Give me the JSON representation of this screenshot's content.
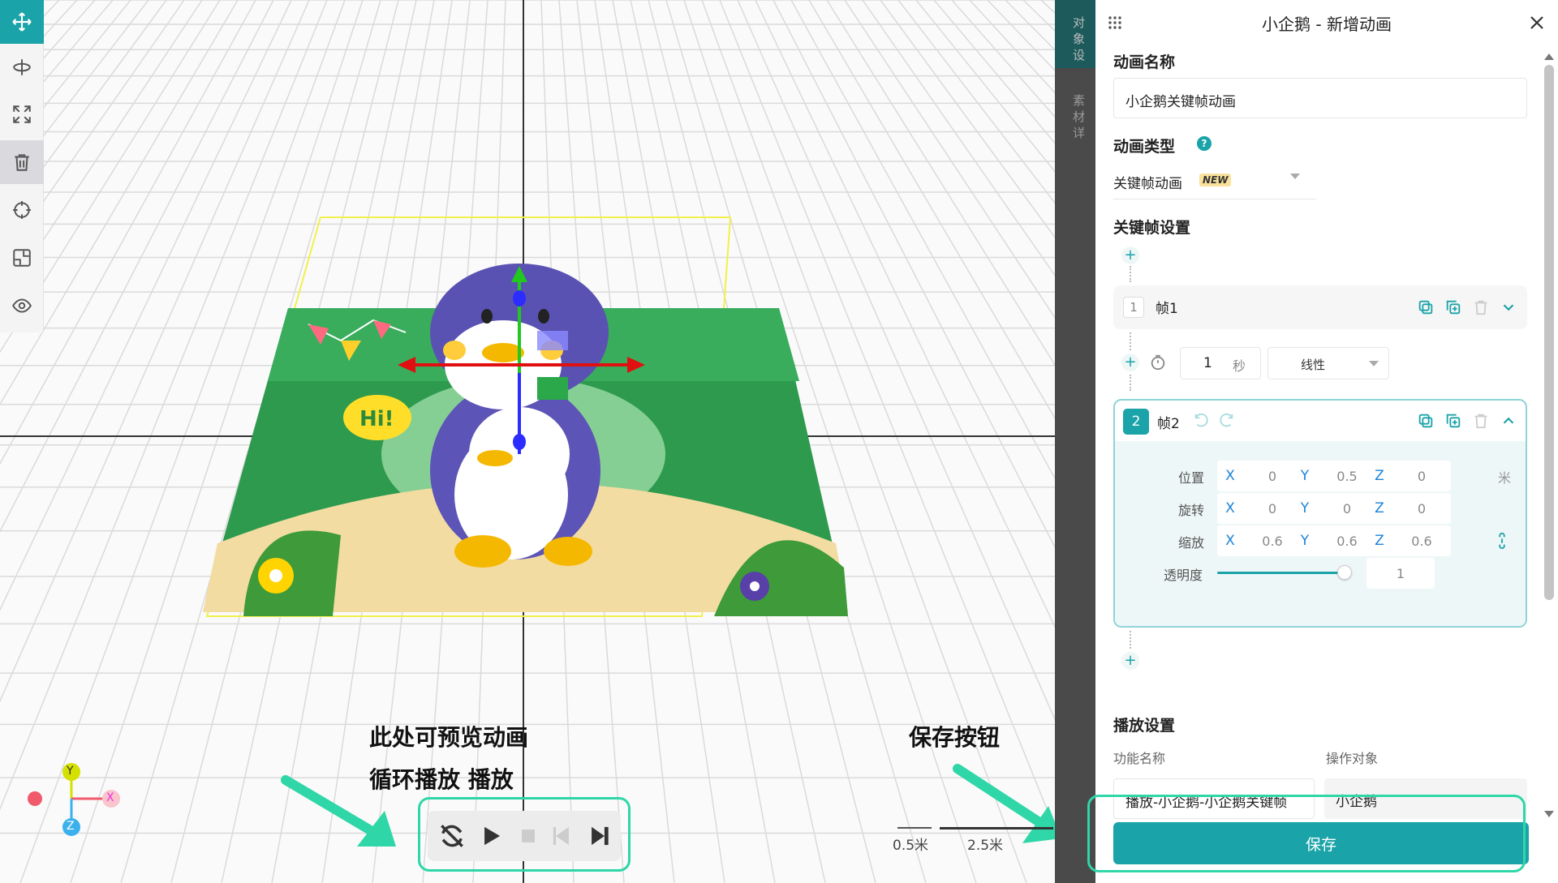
{
  "toolbar": {
    "tools": [
      "move-tool",
      "rotate-tool",
      "scale-tool",
      "delete-tool",
      "focus-tool",
      "fit-tool",
      "visibility-tool"
    ]
  },
  "colors": {
    "accent": "#1aa3a8",
    "highlight": "#2fd6a7",
    "axis_x": "#f05a6a",
    "axis_y": "#d4e000",
    "axis_z": "#3ab0ec"
  },
  "viewport": {
    "axis_labels": {
      "y": "Y",
      "x": "X",
      "z": "Z"
    },
    "scale_small": "0.5米",
    "scale_large": "2.5米",
    "annotation_preview_line1": "此处可预览动画",
    "annotation_preview_line2": "循环播放 播放",
    "annotation_save": "保存按钮",
    "playback_controls": [
      "loop-icon",
      "play-icon",
      "stop-icon",
      "step-back-icon",
      "step-forward-icon"
    ]
  },
  "overlay": {
    "text1": "对象设",
    "text2": "素材详"
  },
  "panel": {
    "title": "小企鹅 - 新增动画",
    "anim_name_label": "动画名称",
    "anim_name_value": "小企鹅关键帧动画",
    "anim_type_label": "动画类型",
    "anim_type_value": "关键帧动画",
    "anim_type_badge": "NEW",
    "keyframe_settings_label": "关键帧设置",
    "frames": [
      {
        "index": "1",
        "name": "帧1"
      },
      {
        "index": "2",
        "name": "帧2"
      }
    ],
    "transition": {
      "duration": "1",
      "unit": "秒",
      "easing": "线性"
    },
    "frame2": {
      "position_label": "位置",
      "position": {
        "x": "0",
        "y": "0.5",
        "z": "0"
      },
      "position_unit": "米",
      "rotation_label": "旋转",
      "rotation": {
        "x": "0",
        "y": "0",
        "z": "0"
      },
      "scale_label": "缩放",
      "scale": {
        "x": "0.6",
        "y": "0.6",
        "z": "0.6"
      },
      "opacity_label": "透明度",
      "opacity": "1",
      "axis_x": "X",
      "axis_y": "Y",
      "axis_z": "Z"
    },
    "playback_label": "播放设置",
    "func_name_label": "功能名称",
    "target_label": "操作对象",
    "func_name_value": "播放-小企鹅-小企鹅关键帧",
    "target_value": "小企鹅",
    "save_label": "保存"
  }
}
